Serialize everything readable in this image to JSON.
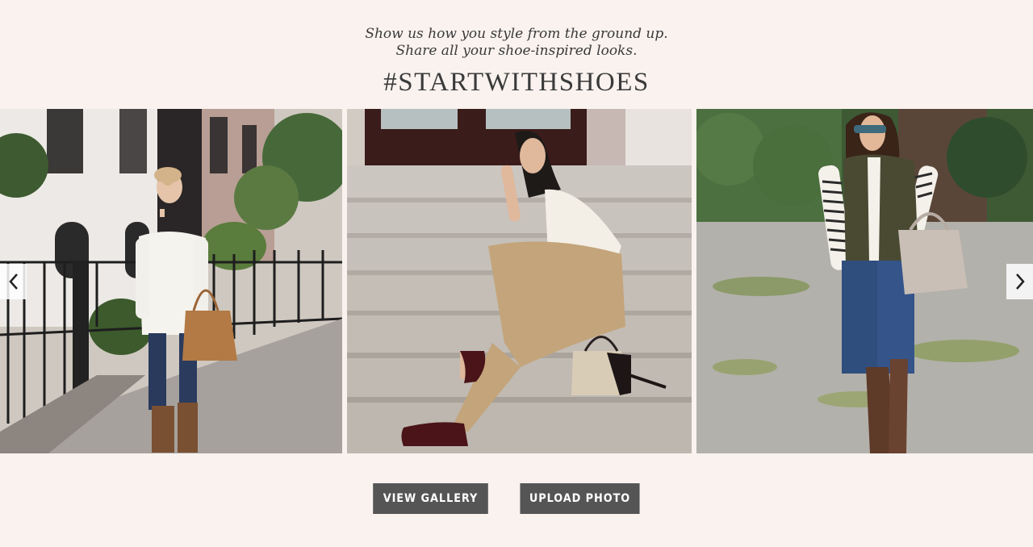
{
  "intro": {
    "line1": "Show us how you style from the ground up.",
    "line2": "Share all your shoe-inspired looks."
  },
  "hashtag": "#STARTWITHSHOES",
  "buttons": {
    "view_gallery": "VIEW GALLERY",
    "upload_photo": "UPLOAD PHOTO"
  },
  "icons": {
    "prev": "chevron-left-icon",
    "next": "chevron-right-icon"
  },
  "colors": {
    "background": "#f9f2ef",
    "button": "#555556",
    "text": "#3a3a3a"
  }
}
